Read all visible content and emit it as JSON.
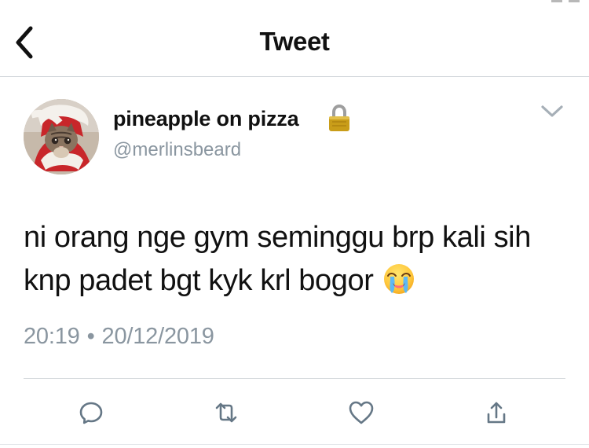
{
  "header": {
    "title": "Tweet",
    "back_icon": "chevron-left-icon"
  },
  "tweet": {
    "author": {
      "display_name": "pineapple on pizza",
      "username": "@merlinsbeard",
      "protected_icon": "lock-icon",
      "avatar": "cat-in-santa-costume-avatar"
    },
    "text": "ni orang nge gym seminggu brp kali sih knp padet bgt kyk krl bogor",
    "emoji": "loudly-crying-face-emoji",
    "time": "20:19",
    "separator": "•",
    "date": "20/12/2019",
    "menu_icon": "chevron-down-icon"
  },
  "actions": [
    {
      "name": "reply",
      "icon": "reply-icon"
    },
    {
      "name": "retweet",
      "icon": "retweet-icon"
    },
    {
      "name": "like",
      "icon": "heart-icon"
    },
    {
      "name": "share",
      "icon": "share-icon"
    }
  ],
  "colors": {
    "text": "#111111",
    "secondary": "#8a96a0",
    "icon": "#657786",
    "divider": "#cfd4d8"
  }
}
